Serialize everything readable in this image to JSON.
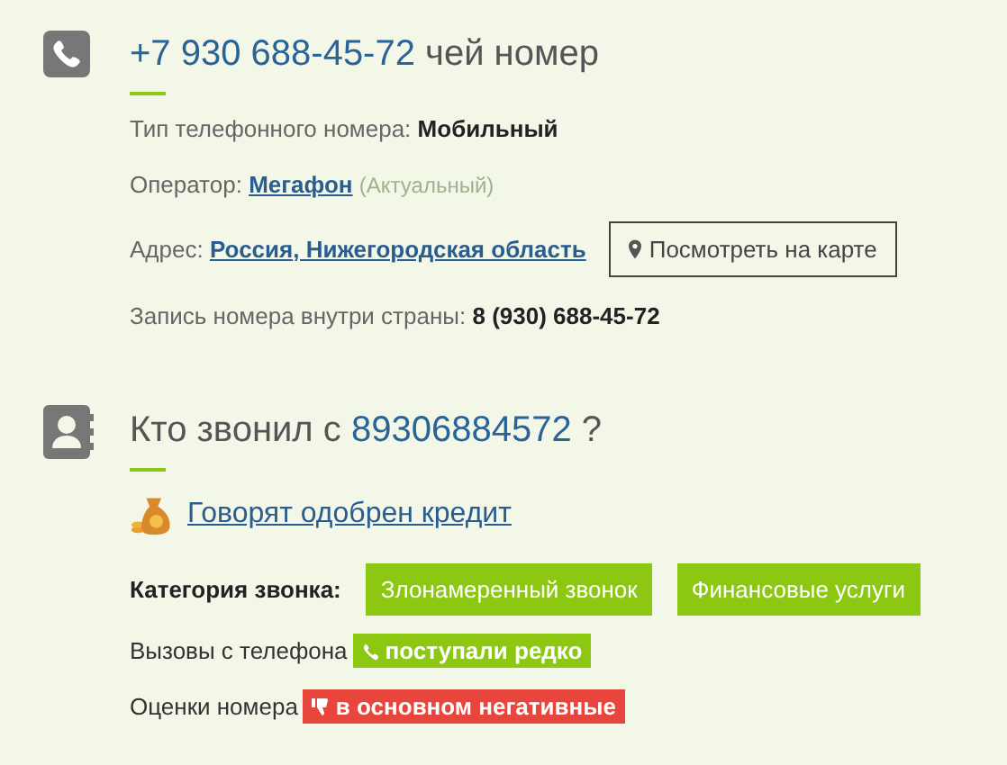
{
  "phone_section": {
    "number": "+7 930 688-45-72",
    "title_suffix": "чей номер",
    "type": {
      "label": "Тип телефонного номера:",
      "value": "Мобильный"
    },
    "operator": {
      "label": "Оператор:",
      "value": "Мегафон",
      "note": "(Актуальный)"
    },
    "address": {
      "label": "Адрес:",
      "value": "Россия, Нижегородская область",
      "map_button": "Посмотреть на карте"
    },
    "domestic": {
      "label": "Запись номера внутри страны:",
      "value": "8 (930) 688-45-72"
    }
  },
  "caller_section": {
    "title_prefix": "Кто звонил с",
    "number": "89306884572",
    "title_suffix": "?",
    "verdict": "Говорят одобрен кредит",
    "category": {
      "label": "Категория звонка:",
      "tags": [
        "Злонамеренный звонок",
        "Финансовые услуги"
      ]
    },
    "stats": [
      {
        "kind": "calls",
        "label": "Вызовы с телефона",
        "badge": "поступали редко",
        "color": "#8cc812"
      },
      {
        "kind": "rating",
        "label": "Оценки номера",
        "badge": "в основном негативные",
        "color": "#e8463c"
      }
    ]
  }
}
